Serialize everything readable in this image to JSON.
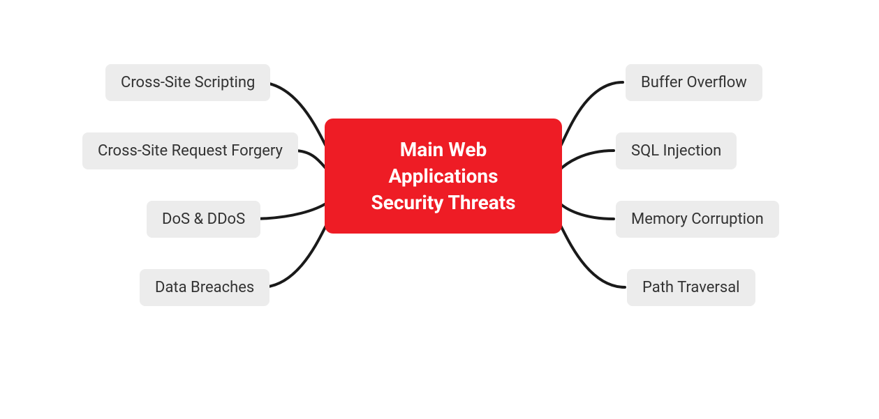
{
  "diagram": {
    "center": {
      "title_line1": "Main Web",
      "title_line2": "Applications",
      "title_line3": "Security Threats"
    },
    "left_nodes": [
      {
        "label": "Cross-Site Scripting"
      },
      {
        "label": "Cross-Site Request Forgery"
      },
      {
        "label": "DoS & DDoS"
      },
      {
        "label": "Data Breaches"
      }
    ],
    "right_nodes": [
      {
        "label": "Buffer Overflow"
      },
      {
        "label": "SQL Injection"
      },
      {
        "label": "Memory Corruption"
      },
      {
        "label": "Path Traversal"
      }
    ],
    "colors": {
      "center_bg": "#ee1c25",
      "center_fg": "#ffffff",
      "node_bg": "#ececec",
      "node_fg": "#333333",
      "connector": "#1a1a1a"
    }
  }
}
